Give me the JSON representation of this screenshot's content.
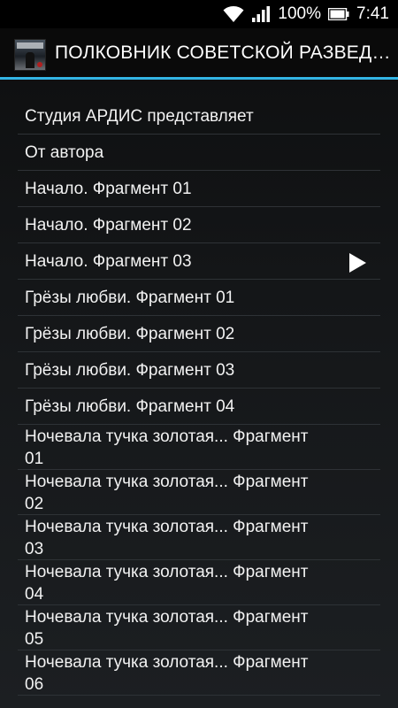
{
  "status_bar": {
    "battery_percent": "100%",
    "time": "7:41",
    "icons": [
      "wifi-icon",
      "signal-icon",
      "battery-icon"
    ]
  },
  "app_bar": {
    "title": "ПОЛКОВНИК СОВЕТСКОЙ РАЗВЕДКИ",
    "icon": "app-icon",
    "accent_color": "#33b5e5"
  },
  "tracks": [
    {
      "label": "Студия АРДИС представляет"
    },
    {
      "label": "От автора"
    },
    {
      "label": "Начало. Фрагмент 01"
    },
    {
      "label": "Начало. Фрагмент 02"
    },
    {
      "label": "Начало. Фрагмент 03",
      "playing": true
    },
    {
      "label": "Грёзы любви. Фрагмент 01"
    },
    {
      "label": "Грёзы любви. Фрагмент 02"
    },
    {
      "label": "Грёзы любви. Фрагмент 03"
    },
    {
      "label": "Грёзы любви. Фрагмент 04"
    },
    {
      "label": "Ночевала тучка золотая... Фрагмент 01"
    },
    {
      "label": "Ночевала тучка золотая... Фрагмент 02"
    },
    {
      "label": "Ночевала тучка золотая... Фрагмент 03"
    },
    {
      "label": "Ночевала тучка золотая... Фрагмент 04"
    },
    {
      "label": "Ночевала тучка золотая... Фрагмент 05"
    },
    {
      "label": "Ночевала тучка золотая... Фрагмент 06"
    }
  ],
  "playing_icon": "play-icon"
}
